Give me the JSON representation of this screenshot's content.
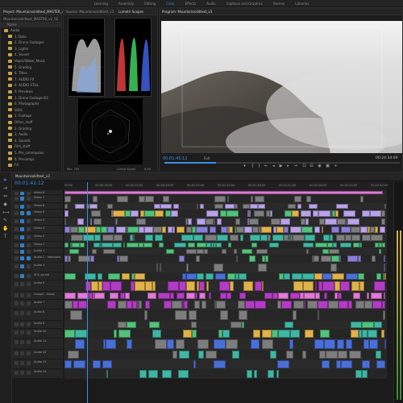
{
  "workspaces": [
    "Learning",
    "Assembly",
    "Editing",
    "Color",
    "Effects",
    "Audio",
    "Captions and Graphics",
    "Review",
    "Libraries"
  ],
  "active_workspace_index": 3,
  "project_panel": {
    "tab": "Project: Mountainsolidtext_MASTER_v2_02",
    "tab2": "Mountainsolidtext_MASTER_v2_02",
    "name_header": "Name",
    "items": [
      "Audio",
      "1. Data",
      "2. Drone Footages",
      "3. Lights",
      "4. Sound",
      "Vapor/Water_Music",
      "5. Grading",
      "6. Titles",
      "7. AUDIO FX",
      "8. AUDIO STILL",
      "9. Previews",
      "1. Drone Footages03",
      "6. Photographs",
      "Stills",
      "1. Footage",
      "Other_stuff",
      "2. Grading",
      "3. Audio",
      "4. Sounds",
      "Film_stuff",
      "5. Pre_commpoles",
      "6. Precomps",
      "FX"
    ]
  },
  "scopes_panel": {
    "tabs": [
      "Source: Mountainsolidtext_v3",
      "Lumetri Scopes"
    ],
    "footer_left": "Rec. 709",
    "footer_mid": "Clamp Signal",
    "footer_right": "8 Bit"
  },
  "program_monitor": {
    "tab": "Program: Mountainsolidtext_v3",
    "timecode_left": "00:01:45:12",
    "fit": "Full",
    "timecode_right": "00:24:34:09"
  },
  "timeline": {
    "tab": "Mountainsolidtext_v3",
    "timecode": "00:01:42:12",
    "ruler": [
      "00:00",
      "00:00:16:00",
      "00:00:32:00",
      "00:00:48:00",
      "00:01:04:00",
      "00:01:20:00",
      "00:01:36:00",
      "00:01:52:00",
      "00:02:08:00",
      "00:02:24:00",
      "00:02:40:00"
    ],
    "tracks": [
      {
        "id": "V8",
        "name": "Video 8"
      },
      {
        "id": "V7",
        "name": "Video 7"
      },
      {
        "id": "V6",
        "name": "Video 6"
      },
      {
        "id": "V5",
        "name": "Video 5"
      },
      {
        "id": "V4",
        "name": "Video 4"
      },
      {
        "id": "V3",
        "name": "Video 3"
      },
      {
        "id": "V2",
        "name": "Video 2"
      },
      {
        "id": "V1",
        "name": "Video 1"
      },
      {
        "id": "A1",
        "name": "Audio 1"
      },
      {
        "id": "A2",
        "name": "Audio 2 - Interview"
      },
      {
        "id": "A3",
        "name": "Audio 3"
      },
      {
        "id": "A4",
        "name": "SFX_sound"
      },
      {
        "id": "A5",
        "name": "Audio 5"
      },
      {
        "id": "A6",
        "name": "Comp2 - Music"
      },
      {
        "id": "A7",
        "name": "Audio 7"
      },
      {
        "id": "A8",
        "name": "Audio 8"
      },
      {
        "id": "A9",
        "name": "Audio 9"
      },
      {
        "id": "A10",
        "name": "Audio 10"
      },
      {
        "id": "A11",
        "name": "Audio 11"
      },
      {
        "id": "A12",
        "name": "Audio 12"
      },
      {
        "id": "A13",
        "name": "Audio 13"
      },
      {
        "id": "A14",
        "name": "Audio 14"
      }
    ]
  },
  "colors": {
    "accent": "#3d8ce6",
    "pink": "#e07ad6",
    "magenta": "#b33cc4",
    "green": "#52c27a",
    "teal": "#3fb6a3",
    "violet": "#8a7fd6",
    "yellow": "#e0b24a",
    "lavender": "#b9a2e8",
    "gray": "#7d7d7d",
    "blue": "#4a6fd6"
  }
}
